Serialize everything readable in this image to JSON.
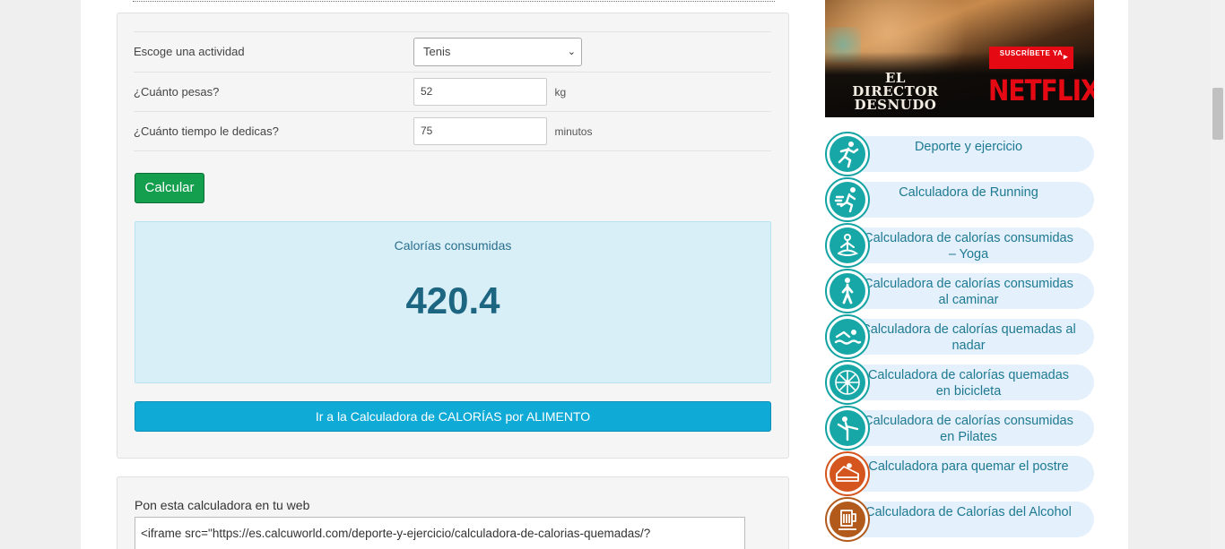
{
  "form": {
    "activity_label": "Escoge una actividad",
    "activity_value": "Tenis",
    "weight_label": "¿Cuánto pesas?",
    "weight_value": "52",
    "weight_unit": "kg",
    "time_label": "¿Cuánto tiempo le dedicas?",
    "time_value": "75",
    "time_unit": "minutos",
    "calc_button": "Calcular"
  },
  "result": {
    "title": "Calorías consumidas",
    "value": "420.4"
  },
  "food_button": "Ir a la Calculadora de CALORÍAS por ALIMENTO",
  "embed": {
    "title": "Pon esta calculadora en tu web",
    "code": "<iframe src=\"https://es.calcuworld.com/deporte-y-ejercicio/calculadora-de-calorias-quemadas/?"
  },
  "ad": {
    "title": "EL DIRECTOR DESNUDO",
    "subscribe": "SUSCRÍBETE YA",
    "brand": "NETFLIX",
    "brand_color": "#e50914"
  },
  "sidebar": {
    "items": [
      {
        "label": "Deporte y ejercicio",
        "icon": "runner-icon"
      },
      {
        "label": "Calculadora de Running",
        "icon": "running-icon"
      },
      {
        "label": "Calculadora de calorías consumidas – Yoga",
        "icon": "yoga-icon"
      },
      {
        "label": "Calculadora de calorías consumidas al caminar",
        "icon": "walking-icon"
      },
      {
        "label": "Calculadora de calorías quemadas al nadar",
        "icon": "swimming-icon"
      },
      {
        "label": "Calculadora de calorías quemadas en bicicleta",
        "icon": "bicycle-wheel-icon"
      },
      {
        "label": "Calculadora de calorías consumidas en Pilates",
        "icon": "pilates-icon"
      },
      {
        "label": "Calculadora para quemar el postre",
        "icon": "cake-icon"
      },
      {
        "label": "Calculadora de Calorías del Alcohol",
        "icon": "beer-mug-icon"
      }
    ]
  },
  "colors": {
    "calc_button": "#139f4d",
    "food_button": "#0faad6",
    "teal": "#17a7a6",
    "orange": "#d4551d"
  }
}
